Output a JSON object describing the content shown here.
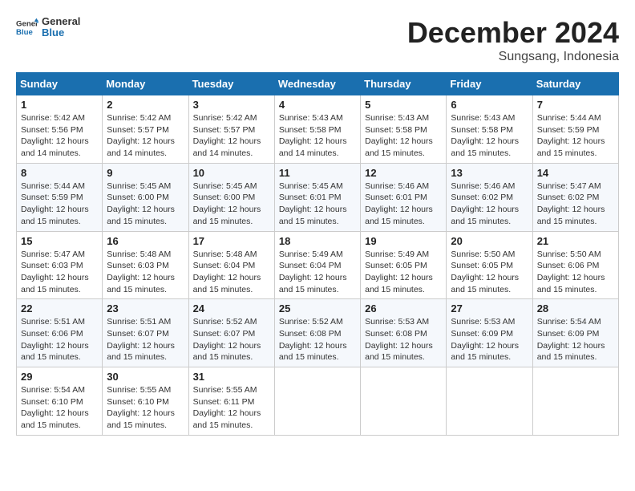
{
  "logo": {
    "text_general": "General",
    "text_blue": "Blue"
  },
  "header": {
    "month": "December 2024",
    "location": "Sungsang, Indonesia"
  },
  "weekdays": [
    "Sunday",
    "Monday",
    "Tuesday",
    "Wednesday",
    "Thursday",
    "Friday",
    "Saturday"
  ],
  "weeks": [
    [
      {
        "day": "1",
        "sunrise": "5:42 AM",
        "sunset": "5:56 PM",
        "daylight": "12 hours and 14 minutes."
      },
      {
        "day": "2",
        "sunrise": "5:42 AM",
        "sunset": "5:57 PM",
        "daylight": "12 hours and 14 minutes."
      },
      {
        "day": "3",
        "sunrise": "5:42 AM",
        "sunset": "5:57 PM",
        "daylight": "12 hours and 14 minutes."
      },
      {
        "day": "4",
        "sunrise": "5:43 AM",
        "sunset": "5:58 PM",
        "daylight": "12 hours and 14 minutes."
      },
      {
        "day": "5",
        "sunrise": "5:43 AM",
        "sunset": "5:58 PM",
        "daylight": "12 hours and 15 minutes."
      },
      {
        "day": "6",
        "sunrise": "5:43 AM",
        "sunset": "5:58 PM",
        "daylight": "12 hours and 15 minutes."
      },
      {
        "day": "7",
        "sunrise": "5:44 AM",
        "sunset": "5:59 PM",
        "daylight": "12 hours and 15 minutes."
      }
    ],
    [
      {
        "day": "8",
        "sunrise": "5:44 AM",
        "sunset": "5:59 PM",
        "daylight": "12 hours and 15 minutes."
      },
      {
        "day": "9",
        "sunrise": "5:45 AM",
        "sunset": "6:00 PM",
        "daylight": "12 hours and 15 minutes."
      },
      {
        "day": "10",
        "sunrise": "5:45 AM",
        "sunset": "6:00 PM",
        "daylight": "12 hours and 15 minutes."
      },
      {
        "day": "11",
        "sunrise": "5:45 AM",
        "sunset": "6:01 PM",
        "daylight": "12 hours and 15 minutes."
      },
      {
        "day": "12",
        "sunrise": "5:46 AM",
        "sunset": "6:01 PM",
        "daylight": "12 hours and 15 minutes."
      },
      {
        "day": "13",
        "sunrise": "5:46 AM",
        "sunset": "6:02 PM",
        "daylight": "12 hours and 15 minutes."
      },
      {
        "day": "14",
        "sunrise": "5:47 AM",
        "sunset": "6:02 PM",
        "daylight": "12 hours and 15 minutes."
      }
    ],
    [
      {
        "day": "15",
        "sunrise": "5:47 AM",
        "sunset": "6:03 PM",
        "daylight": "12 hours and 15 minutes."
      },
      {
        "day": "16",
        "sunrise": "5:48 AM",
        "sunset": "6:03 PM",
        "daylight": "12 hours and 15 minutes."
      },
      {
        "day": "17",
        "sunrise": "5:48 AM",
        "sunset": "6:04 PM",
        "daylight": "12 hours and 15 minutes."
      },
      {
        "day": "18",
        "sunrise": "5:49 AM",
        "sunset": "6:04 PM",
        "daylight": "12 hours and 15 minutes."
      },
      {
        "day": "19",
        "sunrise": "5:49 AM",
        "sunset": "6:05 PM",
        "daylight": "12 hours and 15 minutes."
      },
      {
        "day": "20",
        "sunrise": "5:50 AM",
        "sunset": "6:05 PM",
        "daylight": "12 hours and 15 minutes."
      },
      {
        "day": "21",
        "sunrise": "5:50 AM",
        "sunset": "6:06 PM",
        "daylight": "12 hours and 15 minutes."
      }
    ],
    [
      {
        "day": "22",
        "sunrise": "5:51 AM",
        "sunset": "6:06 PM",
        "daylight": "12 hours and 15 minutes."
      },
      {
        "day": "23",
        "sunrise": "5:51 AM",
        "sunset": "6:07 PM",
        "daylight": "12 hours and 15 minutes."
      },
      {
        "day": "24",
        "sunrise": "5:52 AM",
        "sunset": "6:07 PM",
        "daylight": "12 hours and 15 minutes."
      },
      {
        "day": "25",
        "sunrise": "5:52 AM",
        "sunset": "6:08 PM",
        "daylight": "12 hours and 15 minutes."
      },
      {
        "day": "26",
        "sunrise": "5:53 AM",
        "sunset": "6:08 PM",
        "daylight": "12 hours and 15 minutes."
      },
      {
        "day": "27",
        "sunrise": "5:53 AM",
        "sunset": "6:09 PM",
        "daylight": "12 hours and 15 minutes."
      },
      {
        "day": "28",
        "sunrise": "5:54 AM",
        "sunset": "6:09 PM",
        "daylight": "12 hours and 15 minutes."
      }
    ],
    [
      {
        "day": "29",
        "sunrise": "5:54 AM",
        "sunset": "6:10 PM",
        "daylight": "12 hours and 15 minutes."
      },
      {
        "day": "30",
        "sunrise": "5:55 AM",
        "sunset": "6:10 PM",
        "daylight": "12 hours and 15 minutes."
      },
      {
        "day": "31",
        "sunrise": "5:55 AM",
        "sunset": "6:11 PM",
        "daylight": "12 hours and 15 minutes."
      },
      null,
      null,
      null,
      null
    ]
  ],
  "labels": {
    "sunrise": "Sunrise:",
    "sunset": "Sunset:",
    "daylight": "Daylight:"
  }
}
